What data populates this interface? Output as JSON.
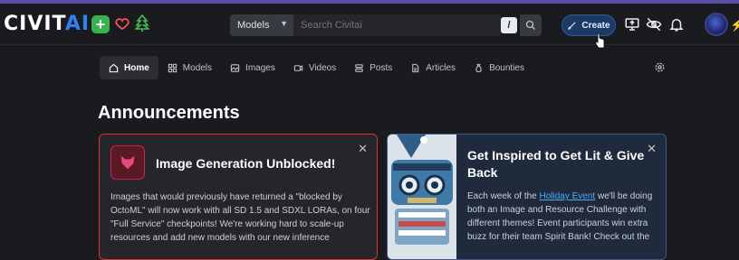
{
  "header": {
    "logo_part1": "CIVIT",
    "logo_part2": "AI",
    "plus_label": "+",
    "search": {
      "category": "Models",
      "placeholder": "Search Civitai",
      "shortcut": "/"
    },
    "create_label": "Create",
    "bolt": "⚡"
  },
  "nav": {
    "items": [
      {
        "label": "Home",
        "icon": "home-icon",
        "active": true
      },
      {
        "label": "Models",
        "icon": "layout-grid-icon"
      },
      {
        "label": "Images",
        "icon": "photo-icon"
      },
      {
        "label": "Videos",
        "icon": "video-icon"
      },
      {
        "label": "Posts",
        "icon": "stack-icon"
      },
      {
        "label": "Articles",
        "icon": "file-text-icon"
      },
      {
        "label": "Bounties",
        "icon": "moneybag-icon"
      }
    ]
  },
  "main": {
    "heading": "Announcements",
    "cards": [
      {
        "title": "Image Generation Unblocked!",
        "close": "✕",
        "body": "Images that would previously have returned a \"blocked by OctoML\" will now work with all SD 1.5 and SDXL LORAs, on four \"Full Service\" checkpoints! We're working hard to scale-up resources and add new models with our new inference"
      },
      {
        "title": "Get Inspired to Get Lit & Give Back",
        "close": "✕",
        "body_pre": "Each week of the ",
        "body_link": "Holiday Event",
        "body_post": " we'll be doing both an Image and Resource Challenge with different themes! Event participants win extra buzz for their team Spirit Bank! Check out the"
      }
    ]
  },
  "colors": {
    "accent_blue": "#2f7ff5",
    "danger_red": "#e03131",
    "link_blue": "#4dabf7"
  }
}
